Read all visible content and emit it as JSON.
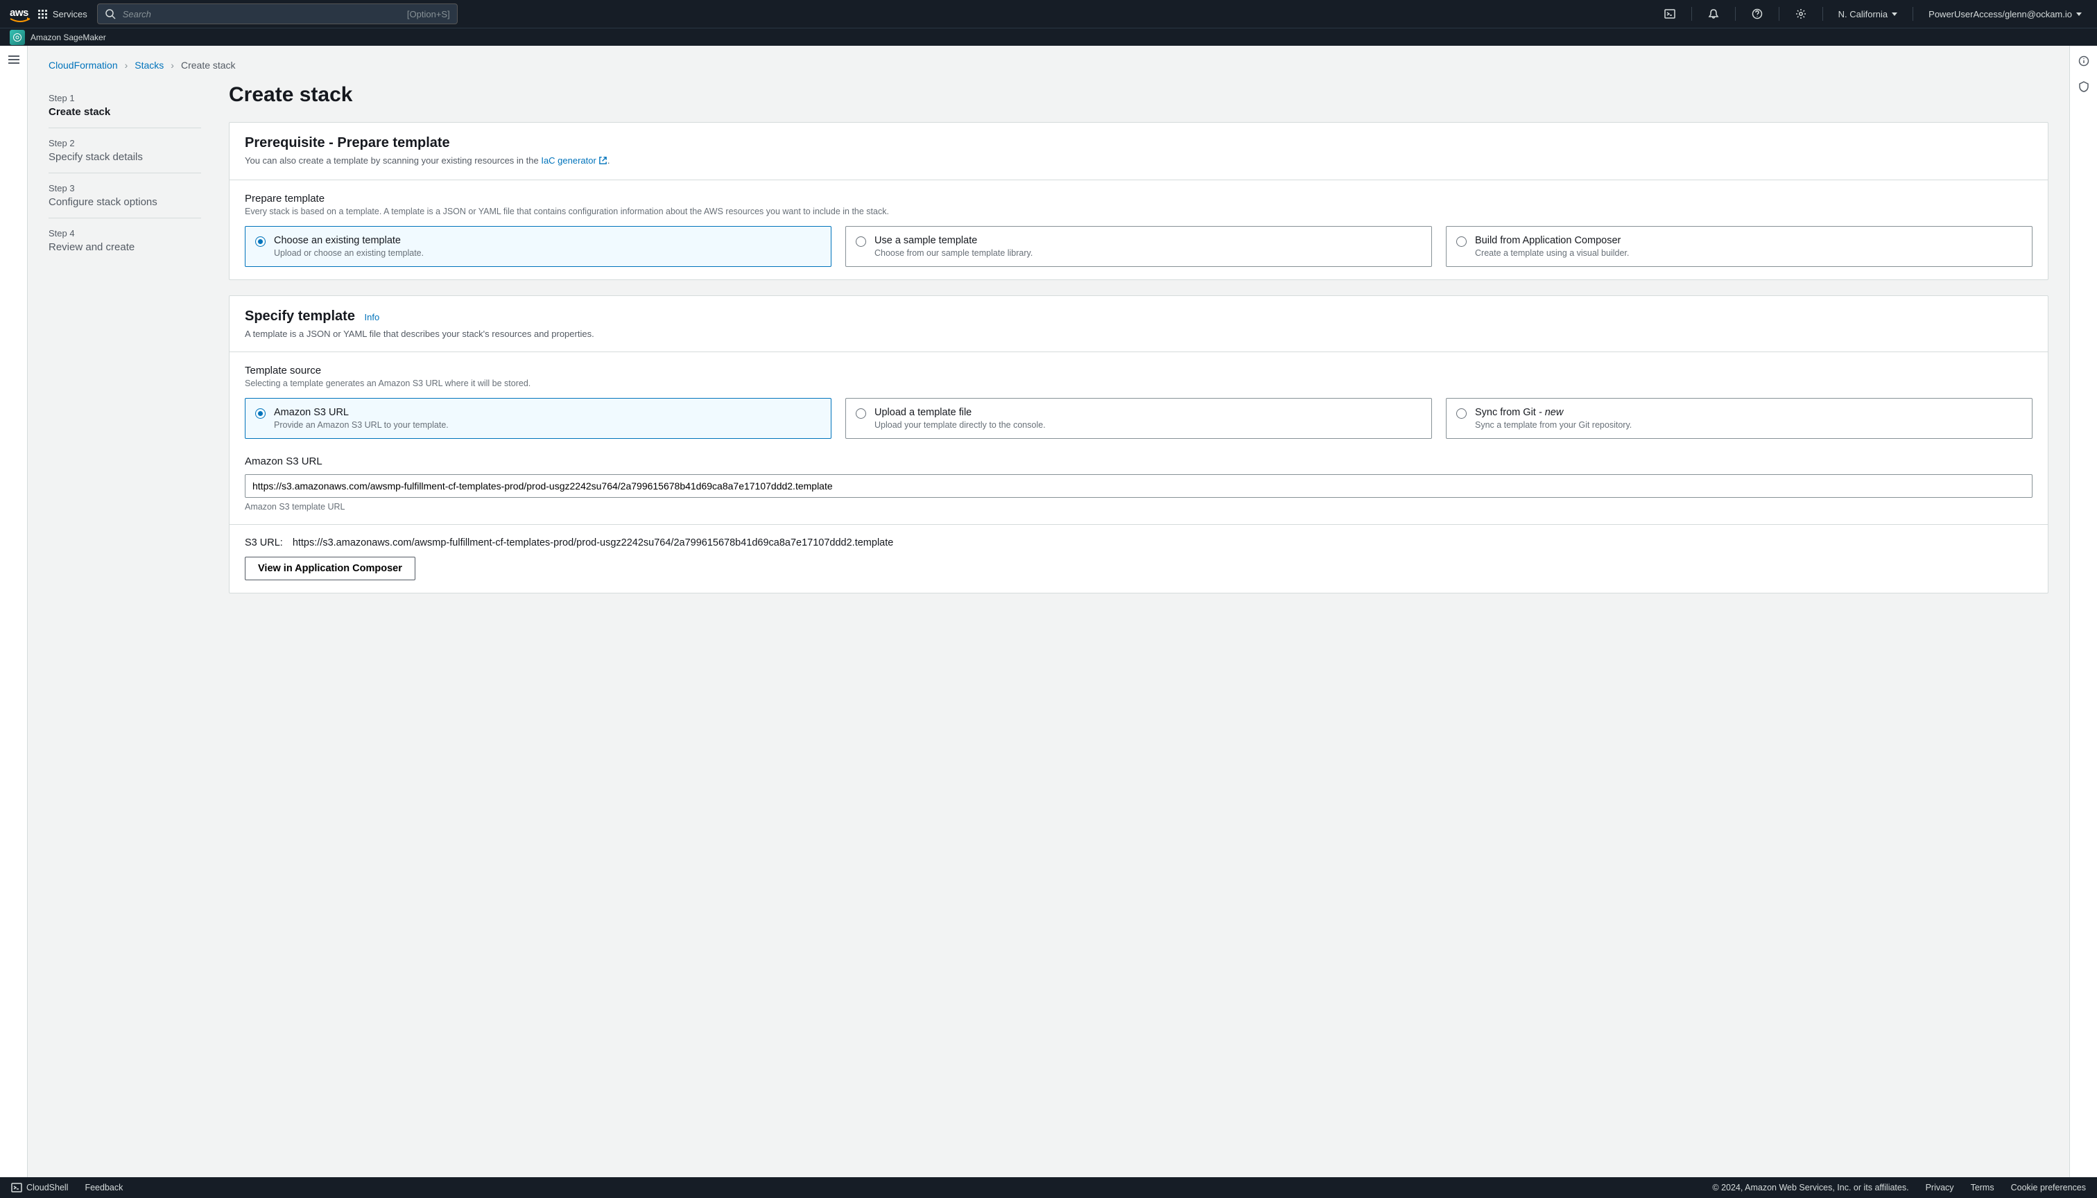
{
  "topnav": {
    "services": "Services",
    "search_placeholder": "Search",
    "search_shortcut": "[Option+S]",
    "region": "N. California",
    "account": "PowerUserAccess/glenn@ockam.io"
  },
  "servicebar": {
    "service_name": "Amazon SageMaker"
  },
  "breadcrumb": {
    "root": "CloudFormation",
    "stacks": "Stacks",
    "current": "Create stack"
  },
  "steps": [
    {
      "num": "Step 1",
      "title": "Create stack",
      "active": true
    },
    {
      "num": "Step 2",
      "title": "Specify stack details",
      "active": false
    },
    {
      "num": "Step 3",
      "title": "Configure stack options",
      "active": false
    },
    {
      "num": "Step 4",
      "title": "Review and create",
      "active": false
    }
  ],
  "page_title": "Create stack",
  "prereq": {
    "heading": "Prerequisite - Prepare template",
    "sub_before": "You can also create a template by scanning your existing resources in the ",
    "sub_link": "IaC generator",
    "sub_after": ".",
    "prepare_label": "Prepare template",
    "prepare_help": "Every stack is based on a template. A template is a JSON or YAML file that contains configuration information about the AWS resources you want to include in the stack.",
    "options": [
      {
        "t": "Choose an existing template",
        "d": "Upload or choose an existing template.",
        "selected": true
      },
      {
        "t": "Use a sample template",
        "d": "Choose from our sample template library.",
        "selected": false
      },
      {
        "t": "Build from Application Composer",
        "d": "Create a template using a visual builder.",
        "selected": false
      }
    ]
  },
  "specify": {
    "heading": "Specify template",
    "info": "Info",
    "sub": "A template is a JSON or YAML file that describes your stack's resources and properties.",
    "source_label": "Template source",
    "source_help": "Selecting a template generates an Amazon S3 URL where it will be stored.",
    "options": [
      {
        "t": "Amazon S3 URL",
        "d": "Provide an Amazon S3 URL to your template.",
        "selected": true,
        "suffix": ""
      },
      {
        "t": "Upload a template file",
        "d": "Upload your template directly to the console.",
        "selected": false,
        "suffix": ""
      },
      {
        "t": "Sync from Git",
        "d": "Sync a template from your Git repository.",
        "selected": false,
        "suffix": " - new"
      }
    ],
    "s3_label": "Amazon S3 URL",
    "s3_value": "https://s3.amazonaws.com/awsmp-fulfillment-cf-templates-prod/prod-usgz2242su764/2a799615678b41d69ca8a7e17107ddd2.template",
    "s3_help": "Amazon S3 template URL",
    "s3_url_label": "S3 URL:",
    "s3_url_value": "https://s3.amazonaws.com/awsmp-fulfillment-cf-templates-prod/prod-usgz2242su764/2a799615678b41d69ca8a7e17107ddd2.template",
    "view_btn": "View in Application Composer"
  },
  "footer": {
    "cloudshell": "CloudShell",
    "feedback": "Feedback",
    "copyright": "© 2024, Amazon Web Services, Inc. or its affiliates.",
    "privacy": "Privacy",
    "terms": "Terms",
    "cookies": "Cookie preferences"
  }
}
